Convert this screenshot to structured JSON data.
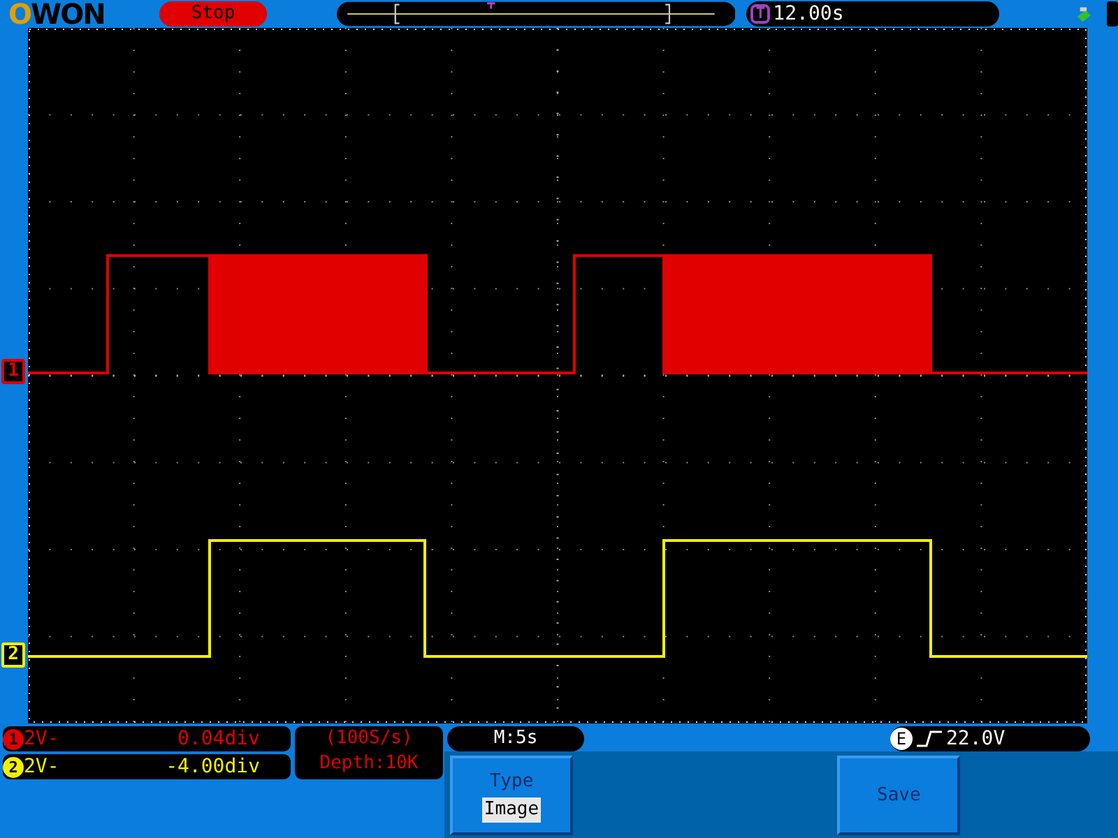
{
  "top_bar": {
    "logo": "OWON",
    "run_state": "Stop",
    "time_badge": "T",
    "trigger_time": "12.00s"
  },
  "channel_markers": [
    {
      "label": "1",
      "color": "#e00000"
    },
    {
      "label": "2",
      "color": "#f0f000"
    }
  ],
  "channels": [
    {
      "number": "1",
      "color": "#e00000",
      "volts": "2V-",
      "offset": "0.04div"
    },
    {
      "number": "2",
      "color": "#f0f000",
      "volts": "2V-",
      "offset": "-4.00div"
    }
  ],
  "acquisition": {
    "sample_rate": "(100S/s)",
    "depth": "Depth:10K"
  },
  "timebase": "M:5s",
  "trigger": {
    "source": "E",
    "level": "22.0V"
  },
  "menu": [
    {
      "title": "Type",
      "value": "Image"
    },
    {
      "title": "Save"
    }
  ]
}
